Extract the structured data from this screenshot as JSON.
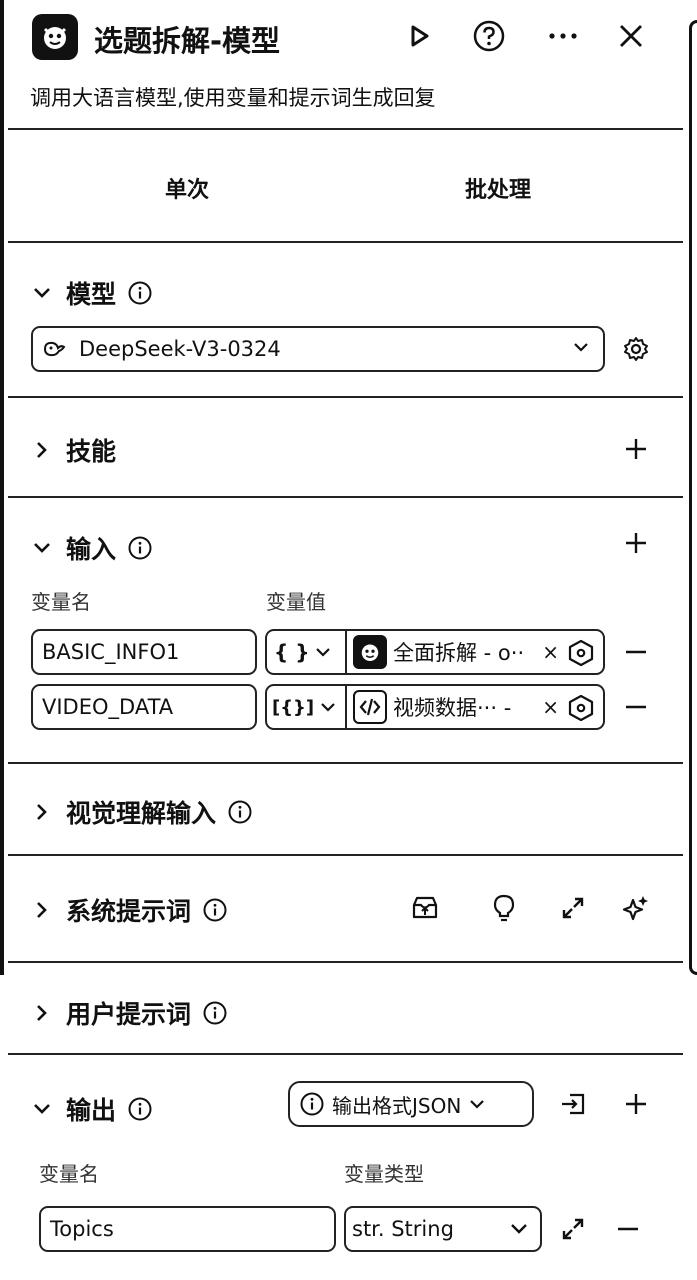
{
  "header": {
    "title": "选题拆解-模型",
    "description": "调用大语言模型,使用变量和提示词生成回复"
  },
  "tabs": [
    "单次",
    "批处理"
  ],
  "model": {
    "title": "模型",
    "selected": "DeepSeek-V3-0324"
  },
  "skills": {
    "title": "技能"
  },
  "input": {
    "title": "输入",
    "col_name": "变量名",
    "col_value": "变量值",
    "rows": [
      {
        "name": "BASIC_INFO1",
        "type_glyph": "{ }",
        "ref_label": "全面拆解 - o··",
        "ref_icon": "coze-logo-icon"
      },
      {
        "name": "VIDEO_DATA",
        "type_glyph": "[{}]",
        "ref_label": "视频数据···  -",
        "ref_icon": "code-icon"
      }
    ]
  },
  "vision": {
    "title": "视觉理解输入"
  },
  "system_prompt": {
    "title": "系统提示词"
  },
  "user_prompt": {
    "title": "用户提示词"
  },
  "output": {
    "title": "输出",
    "format_label": "输出格式JSON",
    "col_name": "变量名",
    "col_type": "变量类型",
    "rows": [
      {
        "name": "Topics",
        "type": "str. String"
      }
    ]
  },
  "colors": {
    "text": "#111111",
    "border": "#222222",
    "background": "#ffffff"
  }
}
